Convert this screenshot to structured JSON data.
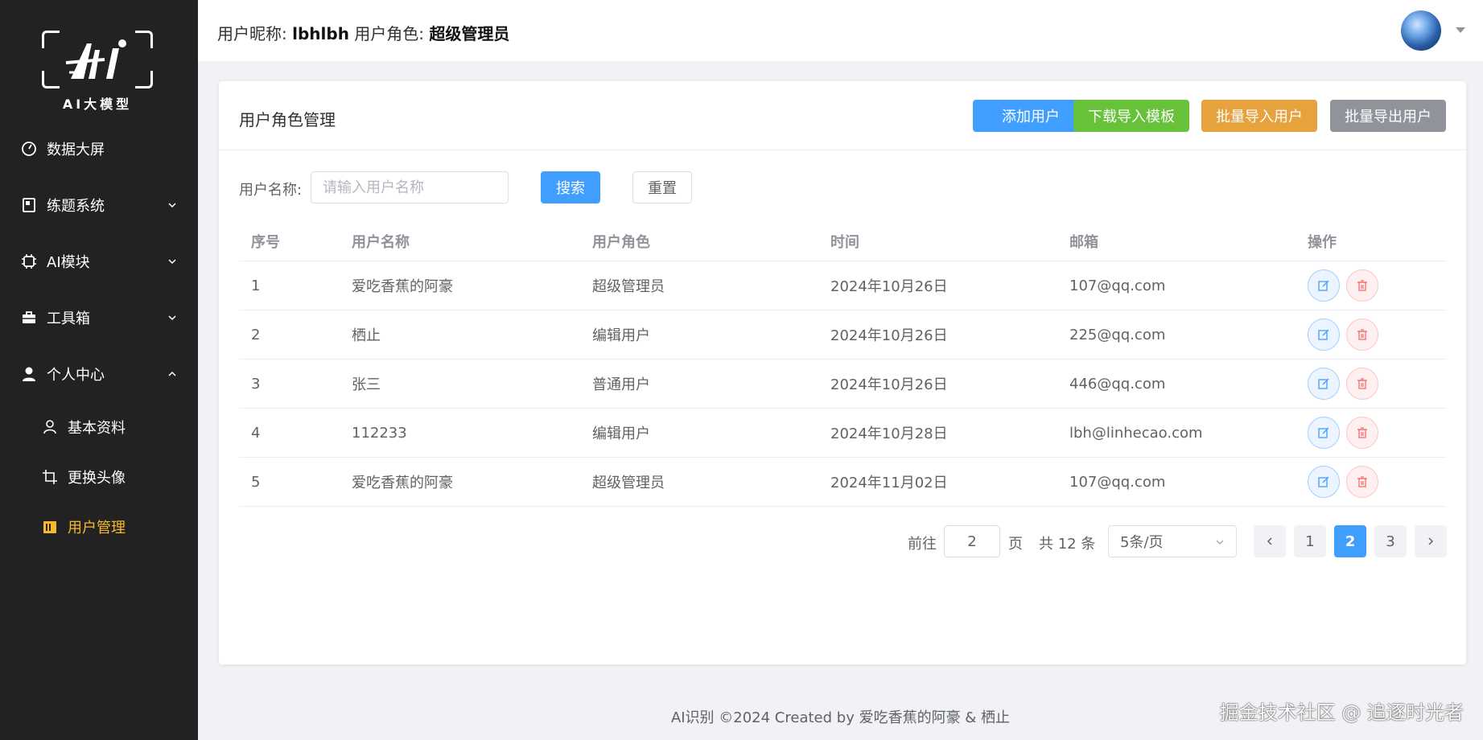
{
  "sidebar": {
    "logo_text": "AI大模型",
    "items": [
      {
        "label": "数据大屏",
        "icon": "dashboard-icon"
      },
      {
        "label": "练题系统",
        "icon": "book-icon"
      },
      {
        "label": "AI模块",
        "icon": "chip-icon"
      },
      {
        "label": "工具箱",
        "icon": "toolbox-icon"
      },
      {
        "label": "个人中心",
        "icon": "user-icon"
      }
    ],
    "subitems": [
      {
        "label": "基本资料",
        "icon": "user-outline-icon"
      },
      {
        "label": "更换头像",
        "icon": "crop-icon"
      },
      {
        "label": "用户管理",
        "icon": "management-icon",
        "active": true
      }
    ],
    "active_color": "#f7ba2a"
  },
  "header": {
    "nickname_label": "用户昵称:",
    "nickname": "lbhlbh",
    "role_label": "用户角色:",
    "role": "超级管理员"
  },
  "card": {
    "title": "用户角色管理",
    "buttons": {
      "add": "添加用户",
      "download": "下载导入模板",
      "import": "批量导入用户",
      "export": "批量导出用户"
    }
  },
  "search": {
    "label": "用户名称:",
    "placeholder": "请输入用户名称",
    "search_button": "搜索",
    "reset_button": "重置"
  },
  "table": {
    "headers": [
      "序号",
      "用户名称",
      "用户角色",
      "时间",
      "邮箱",
      "操作"
    ],
    "rows": [
      {
        "idx": "1",
        "name": "爱吃香蕉的阿豪",
        "role": "超级管理员",
        "time": "2024年10月26日",
        "email": "107@qq.com"
      },
      {
        "idx": "2",
        "name": "栖止",
        "role": "编辑用户",
        "time": "2024年10月26日",
        "email": "225@qq.com"
      },
      {
        "idx": "3",
        "name": "张三",
        "role": "普通用户",
        "time": "2024年10月26日",
        "email": "446@qq.com"
      },
      {
        "idx": "4",
        "name": "112233",
        "role": "编辑用户",
        "time": "2024年10月28日",
        "email": "lbh@linhecao.com"
      },
      {
        "idx": "5",
        "name": "爱吃香蕉的阿豪",
        "role": "超级管理员",
        "time": "2024年11月02日",
        "email": "107@qq.com"
      }
    ]
  },
  "pagination": {
    "goto_label": "前往",
    "current_input": "2",
    "page_label": "页",
    "total_label": "共 12 条",
    "page_size": "5条/页",
    "pages": [
      "1",
      "2",
      "3"
    ],
    "current_page": 2
  },
  "footer": {
    "text": "AI识别 ©2024 Created by 爱吃香蕉的阿豪 & 栖止"
  },
  "watermark": "掘金技术社区 @ 追逐时光者",
  "colors": {
    "primary": "#409eff",
    "success": "#67c23a",
    "warning": "#e6a23c",
    "info": "#909399",
    "danger": "#f56c6c"
  }
}
